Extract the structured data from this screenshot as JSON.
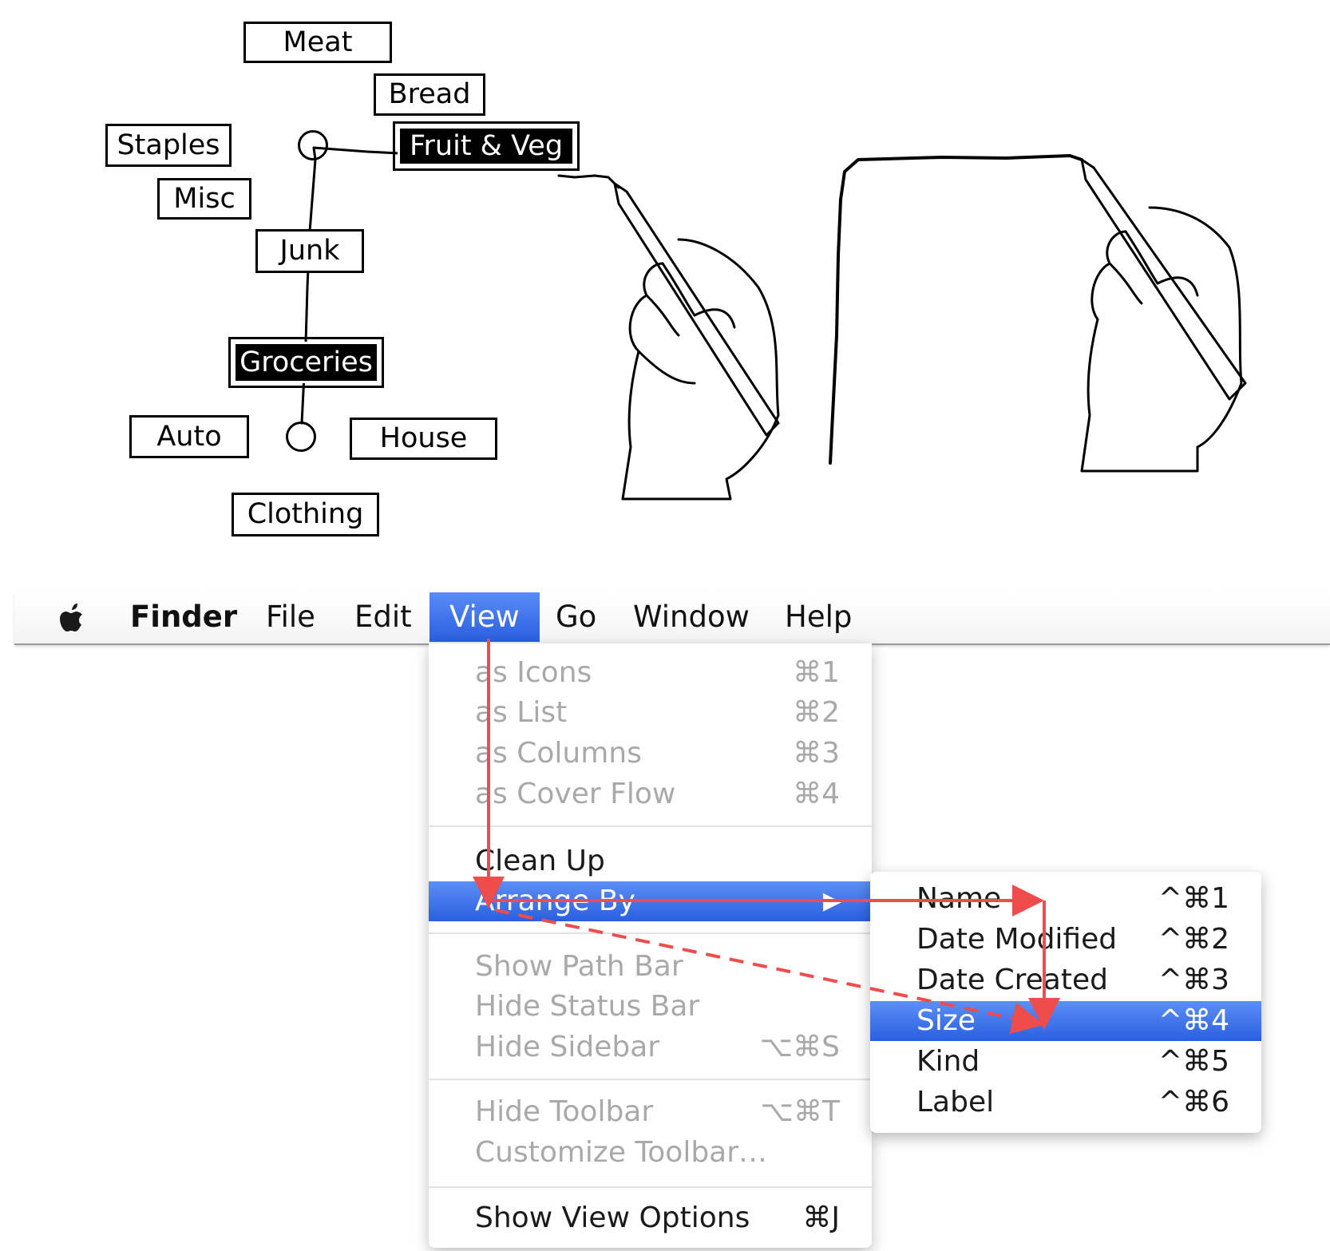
{
  "marking_menu": {
    "items": {
      "meat": "Meat",
      "bread": "Bread",
      "staples": "Staples",
      "fruit_veg": "Fruit & Veg",
      "misc": "Misc",
      "junk": "Junk",
      "groceries": "Groceries",
      "auto": "Auto",
      "house": "House",
      "clothing": "Clothing"
    }
  },
  "menubar": {
    "app": "Finder",
    "items": [
      "File",
      "Edit",
      "View",
      "Go",
      "Window",
      "Help"
    ],
    "active": "View"
  },
  "view_menu": {
    "items": [
      {
        "label": "as Icons",
        "shortcut": "⌘1",
        "enabled": false
      },
      {
        "label": "as List",
        "shortcut": "⌘2",
        "enabled": false
      },
      {
        "label": "as Columns",
        "shortcut": "⌘3",
        "enabled": false
      },
      {
        "label": "as Cover Flow",
        "shortcut": "⌘4",
        "enabled": false
      },
      {
        "label": "Clean Up",
        "shortcut": "",
        "enabled": true
      },
      {
        "label": "Arrange By",
        "shortcut": "▶",
        "enabled": true,
        "highlighted": true
      },
      {
        "label": "Show Path Bar",
        "shortcut": "",
        "enabled": false
      },
      {
        "label": "Hide Status Bar",
        "shortcut": "",
        "enabled": false
      },
      {
        "label": "Hide Sidebar",
        "shortcut": "⌥⌘S",
        "enabled": false
      },
      {
        "label": "Hide Toolbar",
        "shortcut": "⌥⌘T",
        "enabled": false
      },
      {
        "label": "Customize Toolbar…",
        "shortcut": "",
        "enabled": false
      },
      {
        "label": "Show View Options",
        "shortcut": "⌘J",
        "enabled": true
      }
    ]
  },
  "arrange_submenu": {
    "items": [
      {
        "label": "Name",
        "shortcut": "^⌘1"
      },
      {
        "label": "Date Modified",
        "shortcut": "^⌘2"
      },
      {
        "label": "Date Created",
        "shortcut": "^⌘3"
      },
      {
        "label": "Size",
        "shortcut": "^⌘4",
        "highlighted": true
      },
      {
        "label": "Kind",
        "shortcut": "^⌘5"
      },
      {
        "label": "Label",
        "shortcut": "^⌘6"
      }
    ]
  },
  "colors": {
    "highlight": "#2f63e3",
    "annotation": "#ef4c4c",
    "disabled_text": "#a9a9a9"
  }
}
